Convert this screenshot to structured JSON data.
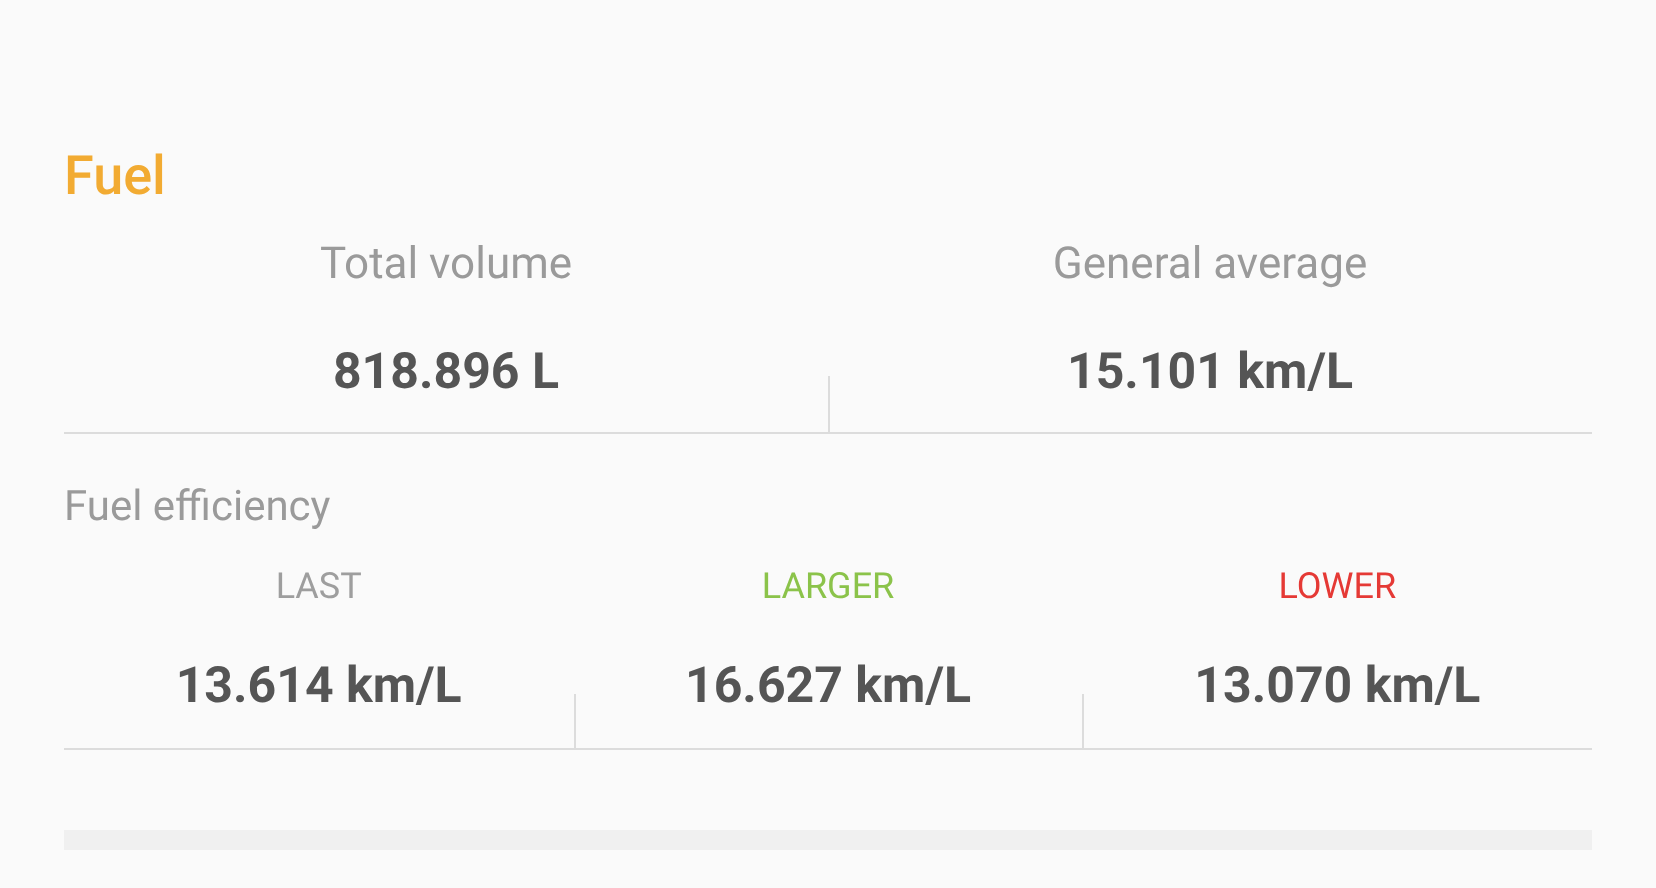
{
  "section_title": "Fuel",
  "totals": [
    {
      "label": "Total volume",
      "value": "818.896 L"
    },
    {
      "label": "General average",
      "value": "15.101 km/L"
    }
  ],
  "efficiency": {
    "title": "Fuel efficiency",
    "items": [
      {
        "label": "LAST",
        "color": "#9e9e9e",
        "value": "13.614 km/L"
      },
      {
        "label": "LARGER",
        "color": "#8bc34a",
        "value": "16.627 km/L"
      },
      {
        "label": "LOWER",
        "color": "#e53935",
        "value": "13.070 km/L"
      }
    ]
  }
}
